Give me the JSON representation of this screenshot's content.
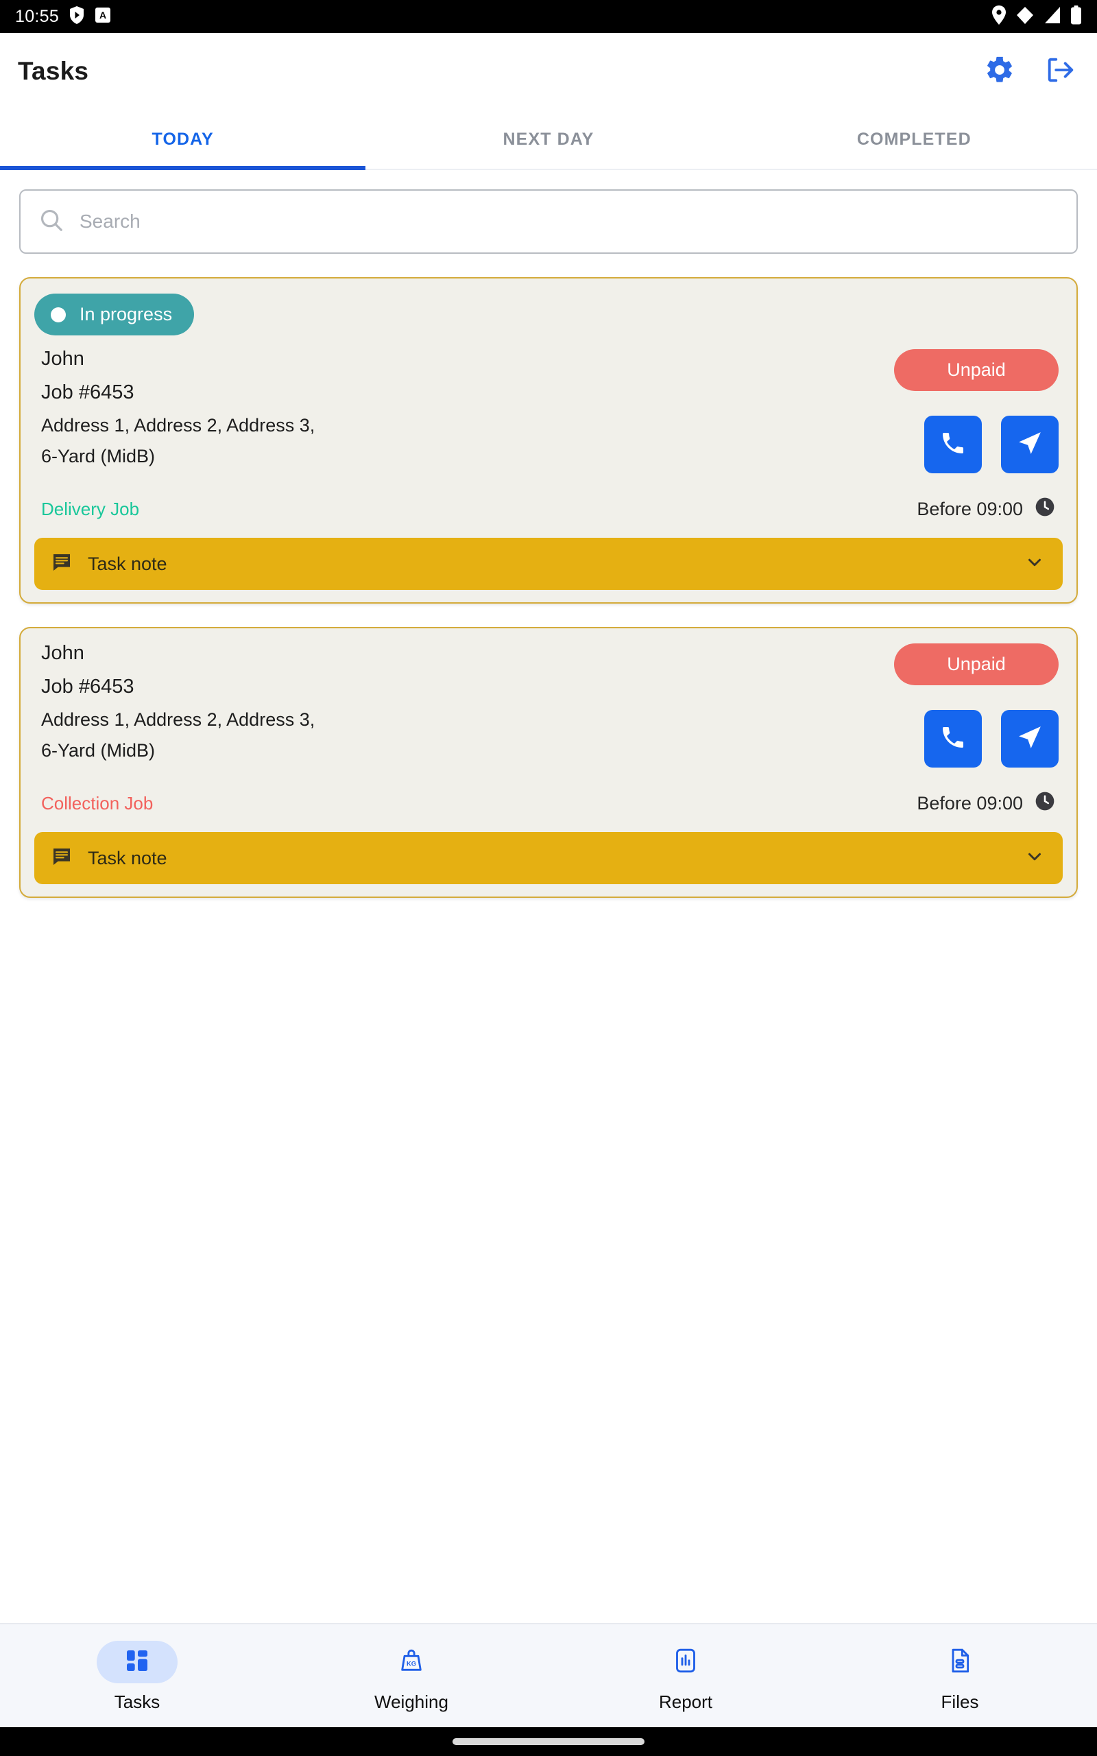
{
  "status_bar": {
    "time": "10:55",
    "left_icons": [
      "play-badge-icon",
      "app-a-icon"
    ],
    "right_icons": [
      "location-icon",
      "wifi-icon",
      "signal-icon",
      "battery-icon"
    ]
  },
  "app_bar": {
    "title": "Tasks",
    "settings_icon": "gear-icon",
    "logout_icon": "logout-icon"
  },
  "tabs": [
    {
      "label": "TODAY",
      "active": true
    },
    {
      "label": "NEXT DAY",
      "active": false
    },
    {
      "label": "COMPLETED",
      "active": false
    }
  ],
  "search": {
    "placeholder": "Search",
    "value": "",
    "icon": "search-icon"
  },
  "colors": {
    "accent_blue": "#1666ee",
    "tab_active": "#1565e8",
    "status_teal": "#3fa4a8",
    "unpaid_red": "#ee6b64",
    "note_amber": "#e5b012",
    "card_bg": "#f1f0ea",
    "card_border": "#d4ab3b",
    "delivery_green": "#19c79a",
    "collection_red": "#f2615c"
  },
  "tasks": [
    {
      "status_badge": "In progress",
      "has_status_badge": true,
      "customer": "John",
      "job_number": "Job #6453",
      "address": "Address 1, Address 2, Address 3,",
      "container": "6-Yard (MidB)",
      "payment_badge": "Unpaid",
      "call_icon": "phone-icon",
      "navigate_icon": "navigation-arrow-icon",
      "job_type": "Delivery Job",
      "job_type_kind": "delivery",
      "time_label": "Before 09:00",
      "clock_icon": "clock-icon",
      "note_label": "Task note",
      "note_icon": "comment-icon",
      "expand_icon": "chevron-down-icon"
    },
    {
      "status_badge": "",
      "has_status_badge": false,
      "customer": "John",
      "job_number": "Job #6453",
      "address": "Address 1, Address 2, Address 3,",
      "container": "6-Yard (MidB)",
      "payment_badge": "Unpaid",
      "call_icon": "phone-icon",
      "navigate_icon": "navigation-arrow-icon",
      "job_type": "Collection Job",
      "job_type_kind": "collection",
      "time_label": "Before 09:00",
      "clock_icon": "clock-icon",
      "note_label": "Task note",
      "note_icon": "comment-icon",
      "expand_icon": "chevron-down-icon"
    }
  ],
  "bottom_nav": [
    {
      "label": "Tasks",
      "icon": "dashboard-grid-icon",
      "active": true
    },
    {
      "label": "Weighing",
      "icon": "weight-kg-icon",
      "active": false
    },
    {
      "label": "Report",
      "icon": "bar-chart-icon",
      "active": false
    },
    {
      "label": "Files",
      "icon": "document-icon",
      "active": false
    }
  ]
}
